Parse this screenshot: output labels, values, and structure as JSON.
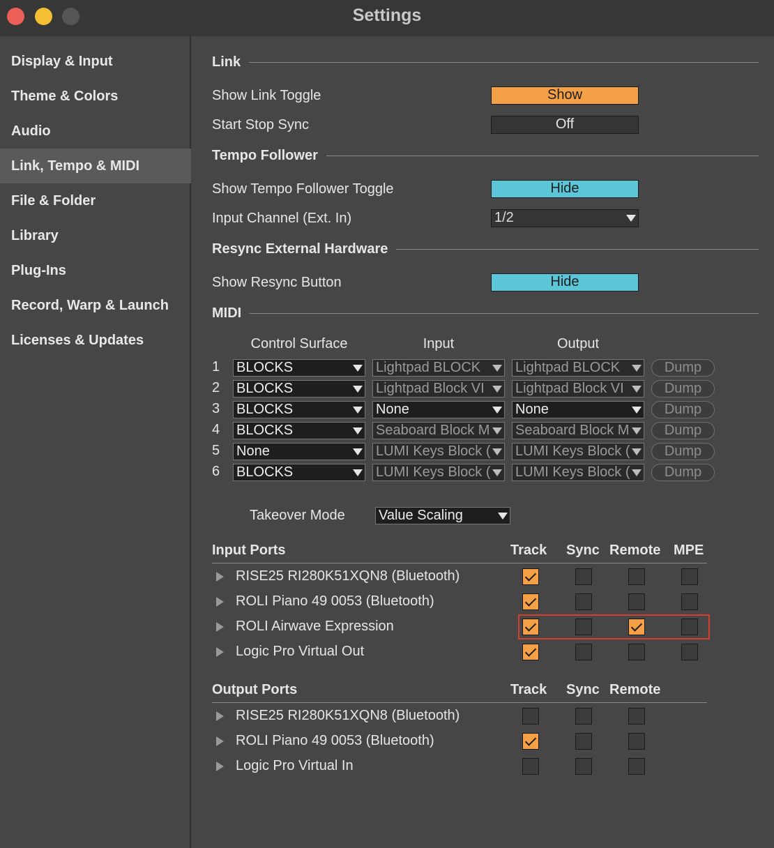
{
  "window": {
    "title": "Settings"
  },
  "sidebar": {
    "items": [
      {
        "label": "Display & Input"
      },
      {
        "label": "Theme & Colors"
      },
      {
        "label": "Audio"
      },
      {
        "label": "Link, Tempo & MIDI",
        "active": true
      },
      {
        "label": "File & Folder"
      },
      {
        "label": "Library"
      },
      {
        "label": "Plug-Ins"
      },
      {
        "label": "Record, Warp & Launch"
      },
      {
        "label": "Licenses & Updates"
      }
    ]
  },
  "link": {
    "heading": "Link",
    "show_toggle_label": "Show Link Toggle",
    "show_toggle_value": "Show",
    "start_stop_label": "Start Stop Sync",
    "start_stop_value": "Off"
  },
  "tempo": {
    "heading": "Tempo Follower",
    "show_toggle_label": "Show Tempo Follower Toggle",
    "show_toggle_value": "Hide",
    "input_channel_label": "Input Channel (Ext. In)",
    "input_channel_value": "1/2"
  },
  "resync": {
    "heading": "Resync External Hardware",
    "show_button_label": "Show Resync Button",
    "show_button_value": "Hide"
  },
  "midi": {
    "heading": "MIDI",
    "col_control_surface": "Control Surface",
    "col_input": "Input",
    "col_output": "Output",
    "dump_label": "Dump",
    "rows": [
      {
        "num": "1",
        "surface": "BLOCKS",
        "input": "Lightpad BLOCK",
        "output": "Lightpad BLOCK"
      },
      {
        "num": "2",
        "surface": "BLOCKS",
        "input": "Lightpad Block VI",
        "output": "Lightpad Block VI"
      },
      {
        "num": "3",
        "surface": "BLOCKS",
        "input": "None",
        "output": "None"
      },
      {
        "num": "4",
        "surface": "BLOCKS",
        "input": "Seaboard Block M",
        "output": "Seaboard Block M"
      },
      {
        "num": "5",
        "surface": "None",
        "input": "LUMI Keys Block (",
        "output": "LUMI Keys Block ("
      },
      {
        "num": "6",
        "surface": "BLOCKS",
        "input": "LUMI Keys Block (",
        "output": "LUMI Keys Block ("
      }
    ],
    "takeover_label": "Takeover Mode",
    "takeover_value": "Value Scaling"
  },
  "input_ports": {
    "heading": "Input Ports",
    "col_track": "Track",
    "col_sync": "Sync",
    "col_remote": "Remote",
    "col_mpe": "MPE",
    "ports": [
      {
        "name": "RISE25 RI280K51XQN8 (Bluetooth)",
        "track": true,
        "sync": false,
        "remote": false,
        "mpe": false
      },
      {
        "name": "ROLI Piano 49 0053 (Bluetooth)",
        "track": true,
        "sync": false,
        "remote": false,
        "mpe": false
      },
      {
        "name": "ROLI Airwave Expression",
        "track": true,
        "sync": false,
        "remote": true,
        "mpe": false
      },
      {
        "name": "Logic Pro Virtual Out",
        "track": true,
        "sync": false,
        "remote": false,
        "mpe": false
      }
    ]
  },
  "output_ports": {
    "heading": "Output Ports",
    "col_track": "Track",
    "col_sync": "Sync",
    "col_remote": "Remote",
    "ports": [
      {
        "name": "RISE25 RI280K51XQN8 (Bluetooth)",
        "track": false,
        "sync": false,
        "remote": false
      },
      {
        "name": "ROLI Piano 49 0053 (Bluetooth)",
        "track": true,
        "sync": false,
        "remote": false
      },
      {
        "name": "Logic Pro Virtual In",
        "track": false,
        "sync": false,
        "remote": false
      }
    ]
  },
  "colors": {
    "accent_orange": "#f4a046",
    "accent_cyan": "#5cc6d8",
    "highlight_red": "#d4402b"
  }
}
